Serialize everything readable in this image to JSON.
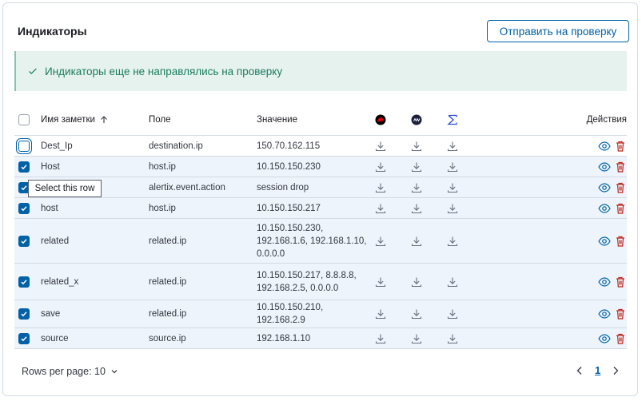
{
  "panel": {
    "title": "Индикаторы",
    "submit_label": "Отправить на проверку"
  },
  "callout": {
    "icon": "check-icon",
    "text": "Индикаторы еще не направлялись на проверку",
    "color": "#1c7c5f"
  },
  "table": {
    "columns": {
      "name": "Имя заметки",
      "name_sort": "ascending",
      "field": "Поле",
      "value": "Значение",
      "integration_1_icon": "red-hat-logo-icon",
      "integration_2_icon": "dark-circle-logo-icon",
      "integration_3_icon": "sigma-icon",
      "actions": "Действия"
    },
    "header_checkbox_checked": false,
    "rows": [
      {
        "checked": false,
        "focused": true,
        "name": "Dest_Ip",
        "field": "destination.ip",
        "value": "150.70.162.115"
      },
      {
        "checked": true,
        "name": "Host",
        "field": "host.ip",
        "value": "10.150.150.230"
      },
      {
        "checked": true,
        "name": "",
        "field": "alertix.event.action",
        "value": "session drop"
      },
      {
        "checked": true,
        "name": "host",
        "field": "host.ip",
        "value": "10.150.150.217"
      },
      {
        "checked": true,
        "name": "related",
        "field": "related.ip",
        "value": "10.150.150.230, 192.168.1.6, 192.168.1.10, 0.0.0.0"
      },
      {
        "checked": true,
        "name": "related_x",
        "field": "related.ip",
        "value": "10.150.150.217, 8.8.8.8, 192.168.2.5, 0.0.0.0"
      },
      {
        "checked": true,
        "name": "save",
        "field": "related.ip",
        "value": "10.150.150.210, 192.168.2.9"
      },
      {
        "checked": true,
        "name": "source",
        "field": "source.ip",
        "value": "192.168.1.10"
      }
    ]
  },
  "tooltip": {
    "text": "Select this row"
  },
  "footer": {
    "rows_per_page": "Rows per page: 10",
    "current_page": "1"
  },
  "colors": {
    "accent": "#0061a6",
    "delete": "#bd271e",
    "selected_row": "#eef4fb"
  }
}
